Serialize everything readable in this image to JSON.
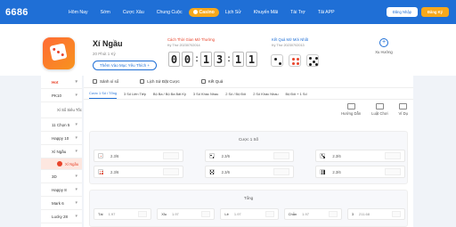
{
  "topbar": {
    "logo": "6686",
    "nav": [
      "Hôm Nay",
      "Sớm",
      "Cược Xâu",
      "Chung Cuộc",
      "Casino",
      "Lịch Sử",
      "Khuyến Mãi",
      "Tài Trợ",
      "Tải APP"
    ],
    "login": "Đăng Nhập",
    "register": "Đăng Ký"
  },
  "game": {
    "title": "Xí Ngầu",
    "subtitle": "20 Phút 1 Kỳ",
    "more_button": "Thêm Vào Mục Yêu Thích +",
    "countdown_label": "Cách Thời Gian Mở Thưởng",
    "countdown_round": "Kỳ Thứ 20230702014",
    "countdown": {
      "h1": "0",
      "h2": "0",
      "m1": "1",
      "m2": "3",
      "s1": "1",
      "s2": "1"
    },
    "result_label": "Kết Quả Mở Mới Nhất",
    "result_round": "Kỳ Thứ 20230702013",
    "result_dice": [
      2,
      4,
      5
    ],
    "trend_label": "Xu Hướng"
  },
  "sidebar": {
    "items": [
      {
        "label": "Hot",
        "type": "hot"
      },
      {
        "label": "PK10",
        "type": "item"
      },
      {
        "label": "Xí Sổ Siêu Tốc",
        "type": "sub"
      },
      {
        "label": "11 Chọn 5",
        "type": "item"
      },
      {
        "label": "Happy 10",
        "type": "item"
      },
      {
        "label": "Xí Ngầu",
        "type": "item"
      },
      {
        "label": "Xí Ngầu",
        "type": "active"
      },
      {
        "label": "3D",
        "type": "item"
      },
      {
        "label": "Happy 8",
        "type": "item"
      },
      {
        "label": "Mark 6",
        "type": "item"
      },
      {
        "label": "Lucky 28",
        "type": "item"
      }
    ]
  },
  "main": {
    "actions": [
      "Sảnh xí sổ",
      "Lịch Sử Đặt Cược",
      "Kết Quả"
    ],
    "tabs": [
      "Cược 1 Số / Tổng",
      "3 Số Liên Tiếp",
      "Bộ Ba / Bộ Ba Bất Kỳ",
      "3 Số Khác Nhau",
      "2 Số / Bộ Đôi",
      "2 Số Khác Nhau",
      "Bộ Đôi + 1 Số"
    ],
    "filters": [
      "Hướng Dẫn",
      "Luật Chơi",
      "Ví Dụ"
    ],
    "panel1_title": "Cược 1 Số",
    "panel1_bets": [
      {
        "die": 1,
        "odd": "2.3/6"
      },
      {
        "die": 2,
        "odd": "2.3/6"
      },
      {
        "die": 3,
        "odd": "2.3/6"
      },
      {
        "die": 4,
        "odd": "2.3/6"
      },
      {
        "die": 5,
        "odd": "2.3/6"
      },
      {
        "die": 6,
        "odd": "2.3/6"
      }
    ],
    "panel2_title": "Tổng",
    "panel2_bets": [
      {
        "label": "Tài",
        "odd": "1.97"
      },
      {
        "label": "Xỉu",
        "odd": "1.97"
      },
      {
        "label": "Lẻ",
        "odd": "1.97"
      },
      {
        "label": "Chẵn",
        "odd": "1.97"
      },
      {
        "label": "3",
        "odd": "211.68"
      }
    ]
  }
}
